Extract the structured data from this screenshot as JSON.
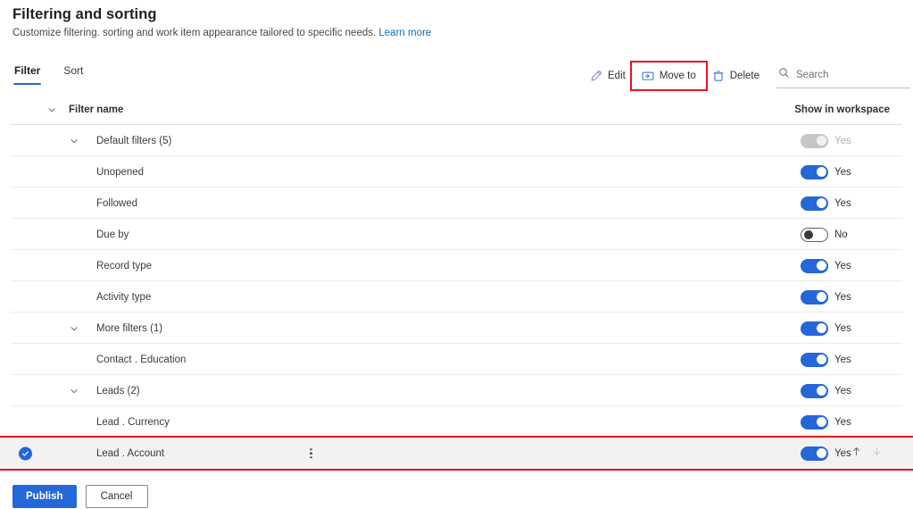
{
  "header": {
    "title": "Filtering and sorting",
    "subtitle": "Customize filtering. sorting and work item appearance tailored to specific needs.",
    "learn_more": "Learn more"
  },
  "tabs": [
    {
      "label": "Filter",
      "active": true
    },
    {
      "label": "Sort",
      "active": false
    }
  ],
  "commandbar": {
    "edit": "Edit",
    "move_to": "Move to",
    "delete": "Delete",
    "search_placeholder": "Search",
    "search_value": "",
    "highlight_color": "#e81123"
  },
  "table": {
    "columns": {
      "name": "Filter name",
      "workspace": "Show in workspace"
    },
    "rows": [
      {
        "name": "Default filters (5)",
        "level": 1,
        "chevron": true,
        "toggle": "disabled",
        "toggle_label": "Yes",
        "selected": false
      },
      {
        "name": "Unopened",
        "level": 2,
        "chevron": false,
        "toggle": "on",
        "toggle_label": "Yes",
        "selected": false
      },
      {
        "name": "Followed",
        "level": 2,
        "chevron": false,
        "toggle": "on",
        "toggle_label": "Yes",
        "selected": false
      },
      {
        "name": "Due by",
        "level": 2,
        "chevron": false,
        "toggle": "off",
        "toggle_label": "No",
        "selected": false
      },
      {
        "name": "Record type",
        "level": 2,
        "chevron": false,
        "toggle": "on",
        "toggle_label": "Yes",
        "selected": false
      },
      {
        "name": "Activity type",
        "level": 2,
        "chevron": false,
        "toggle": "on",
        "toggle_label": "Yes",
        "selected": false
      },
      {
        "name": "More filters (1)",
        "level": 1,
        "chevron": true,
        "toggle": "on",
        "toggle_label": "Yes",
        "selected": false
      },
      {
        "name": "Contact . Education",
        "level": 2,
        "chevron": false,
        "toggle": "on",
        "toggle_label": "Yes",
        "selected": false
      },
      {
        "name": "Leads (2)",
        "level": 1,
        "chevron": true,
        "toggle": "on",
        "toggle_label": "Yes",
        "selected": false
      },
      {
        "name": "Lead . Currency",
        "level": 2,
        "chevron": false,
        "toggle": "on",
        "toggle_label": "Yes",
        "selected": false
      },
      {
        "name": "Lead . Account",
        "level": 2,
        "chevron": false,
        "toggle": "on",
        "toggle_label": "Yes",
        "selected": true
      }
    ]
  },
  "footer": {
    "publish": "Publish",
    "cancel": "Cancel"
  },
  "colors": {
    "accent": "#2566d8",
    "highlight": "#e81123",
    "link": "#0f6cbd"
  }
}
